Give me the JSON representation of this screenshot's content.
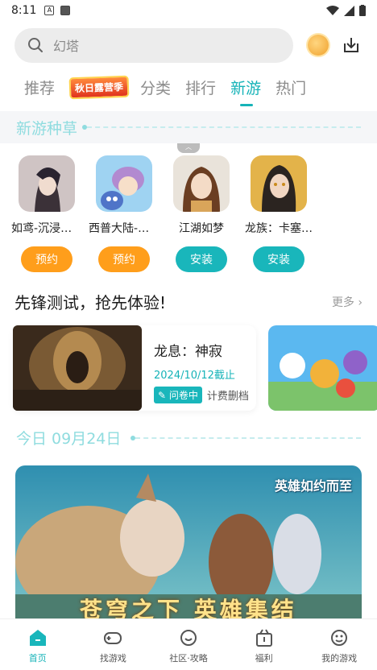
{
  "status_bar": {
    "time": "8:11",
    "notif_a": "A"
  },
  "search": {
    "placeholder": "幻塔"
  },
  "tabs": [
    {
      "label": "推荐"
    },
    {
      "label": "秋日露营季"
    },
    {
      "label": "分类"
    },
    {
      "label": "排行"
    },
    {
      "label": "新游"
    },
    {
      "label": "热门"
    }
  ],
  "new_games": {
    "title": "新游种草",
    "items": [
      {
        "name": "如鸢-沉浸式…",
        "button": "预约",
        "button_color": "#ff9e1b"
      },
      {
        "name": "西普大陆-回…",
        "button": "预约",
        "button_color": "#ff9e1b"
      },
      {
        "name": "江湖如梦",
        "button": "安装",
        "button_color": "#19b6bb"
      },
      {
        "name": "龙族：卡塞…",
        "button": "安装",
        "button_color": "#19b6bb"
      }
    ]
  },
  "vanguard": {
    "title": "先锋测试，抢先体验!",
    "more": "更多",
    "card": {
      "name": "龙息：神寂",
      "date": "2024/10/12截止",
      "tag": "问卷中",
      "tag2": "计费删档"
    }
  },
  "today": {
    "title": "今日 09月24日",
    "banner_logo": "英雄如约而至",
    "banner_text": "苍穹之下 英雄集结"
  },
  "bottom_nav": [
    {
      "label": "首页",
      "active": true
    },
    {
      "label": "找游戏"
    },
    {
      "label": "社区·攻略"
    },
    {
      "label": "福利"
    },
    {
      "label": "我的游戏"
    }
  ],
  "colors": {
    "accent": "#16b3b8",
    "orange": "#ff9e1b",
    "section_title": "#8fdcdf"
  }
}
